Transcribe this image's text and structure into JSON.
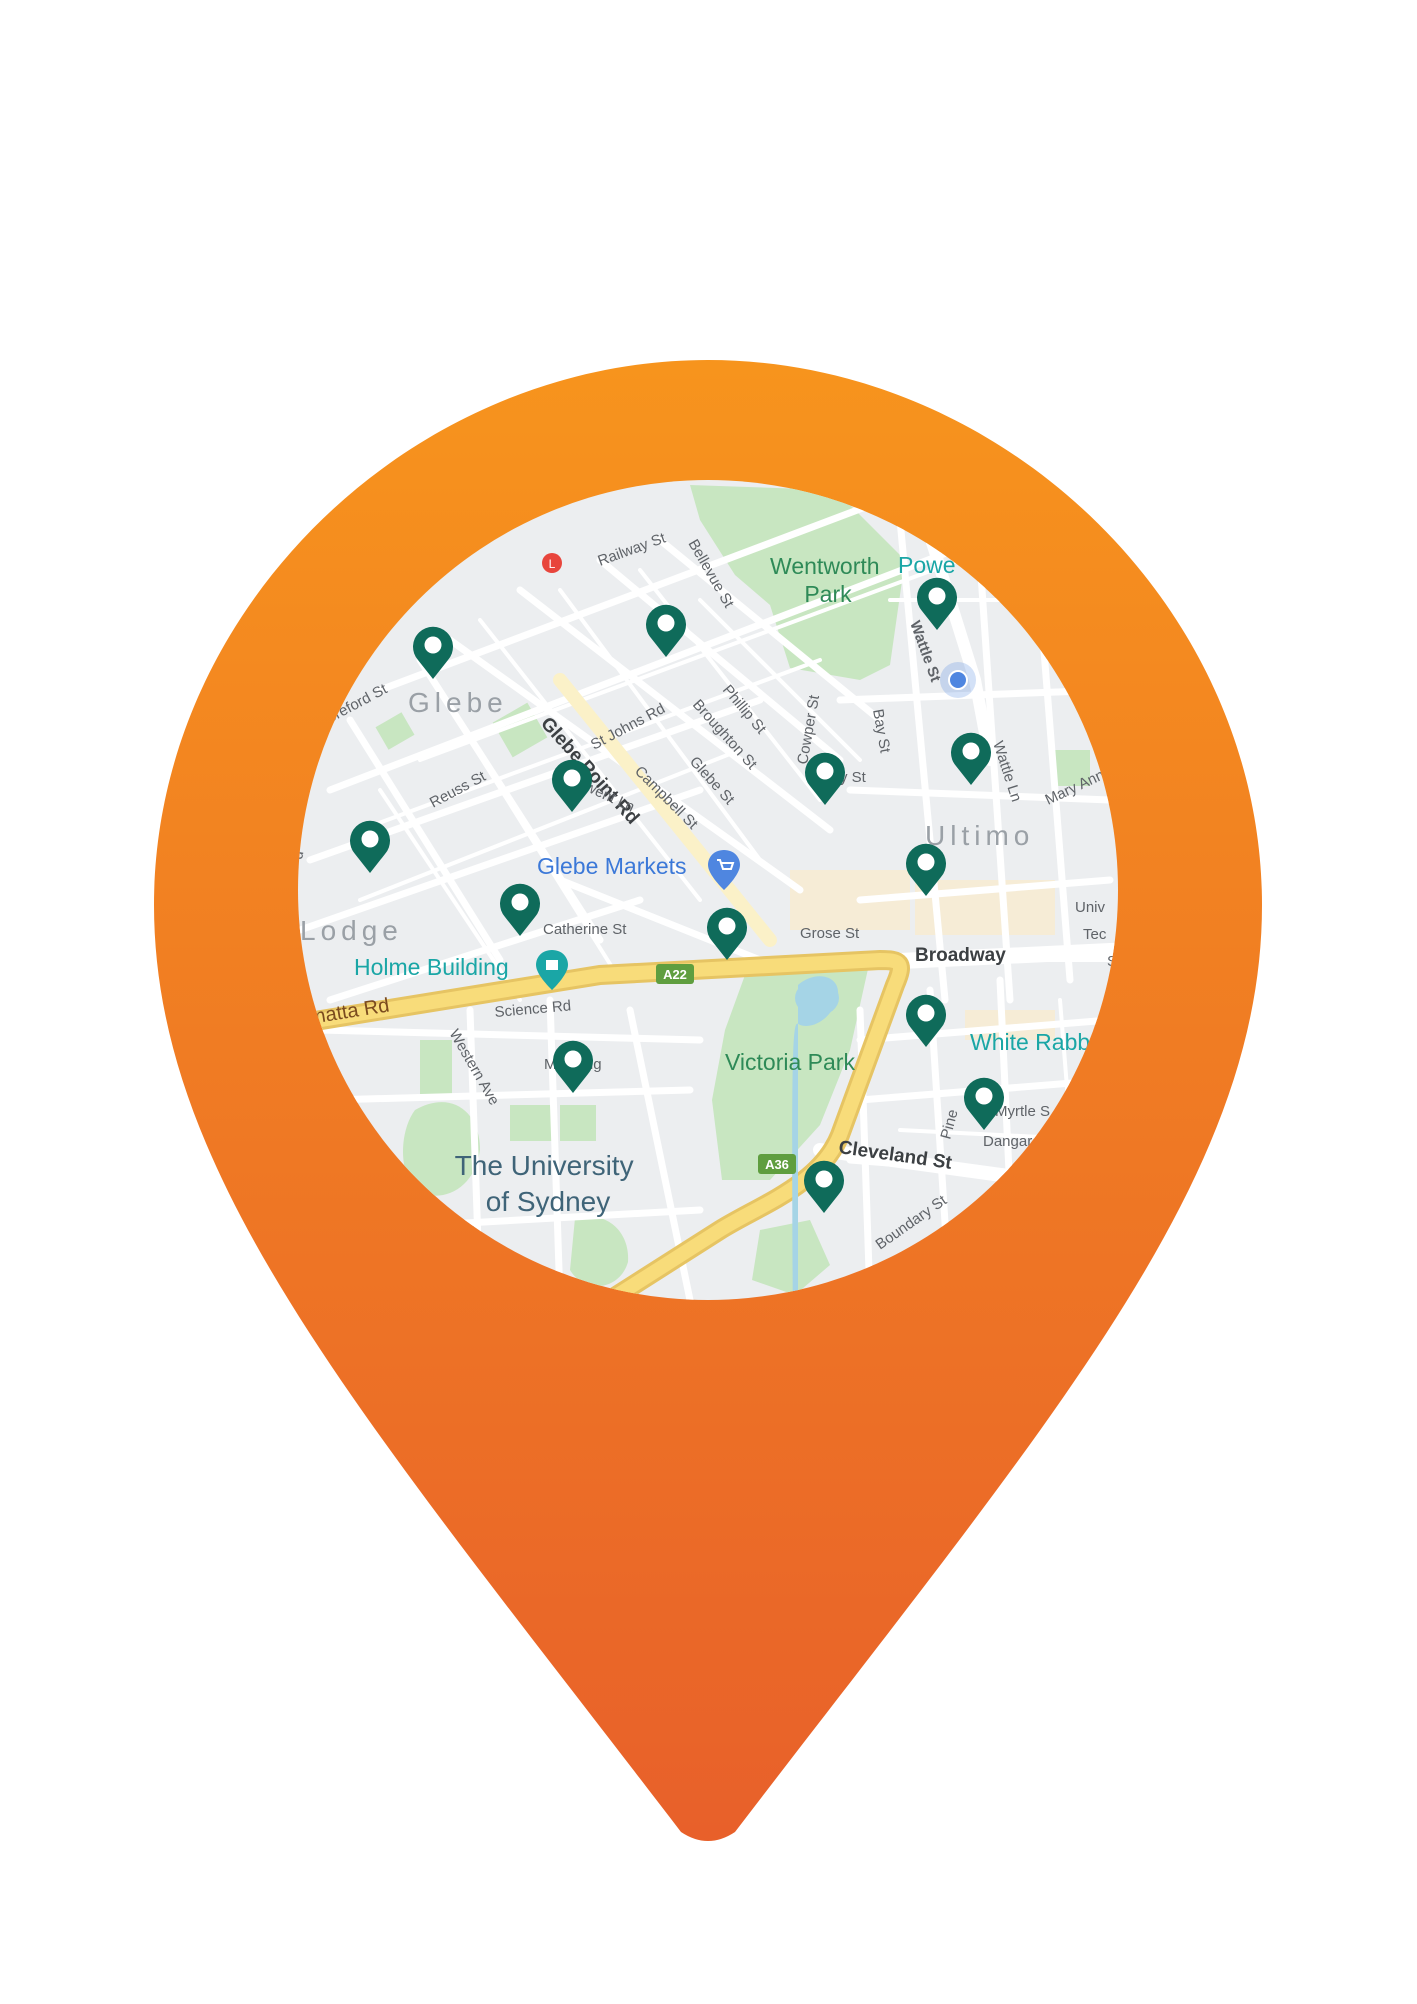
{
  "colors": {
    "pin_top": "#f7941d",
    "pin_bottom": "#e8602a",
    "marker": "#0f6b5a",
    "park": "#c8e6c1",
    "highway": "#f8dc7a",
    "map_bg": "#eceef0"
  },
  "icons": {
    "outer": "location-pin-icon",
    "marker": "map-marker-icon",
    "market": "shopping-cart-icon",
    "landmark": "building-icon",
    "station": "light-rail-icon"
  },
  "map": {
    "district_labels": {
      "glebe": "Glebe",
      "ultimo": "Ultimo",
      "lodge": "Lodge"
    },
    "street_labels": {
      "railway": "Railway St",
      "bellevue": "Bellevue St",
      "st_johns": "St Johns Rd",
      "phillip": "Phillip St",
      "broughton": "Broughton St",
      "cowper": "Cowper St",
      "bay": "Bay St",
      "wattle": "Wattle St",
      "wattle_ln": "Wattle Ln",
      "mary_ann": "Mary Ann",
      "reuss": "Reuss St",
      "hereford": "ereford St",
      "glebe_point": "Glebe Point Rd",
      "went_ln": "went Ln",
      "campbell": "Campbell St",
      "glebe_st": "Glebe St",
      "quarry": "ry St",
      "catherine": "Catherine St",
      "grose": "Grose St",
      "broadway": "Broadway",
      "parramatta": "matta Rd",
      "science": "Science Rd",
      "western": "Western Ave",
      "manning": "Manning",
      "cleveland": "Cleveland St",
      "pine": "Pine",
      "myrtle": "Myrtle S",
      "dangar": "Dangar",
      "boundary": "Boundary St",
      "road_stub": "d"
    },
    "places": {
      "wentworth_line1": "Wentworth",
      "wentworth_line2": "Park",
      "powerhouse": "Powe",
      "glebe_markets": "Glebe Markets",
      "holme_building": "Holme Building",
      "victoria_park": "Victoria Park",
      "white_rabbit": "White Rabb",
      "university_line1": "The University",
      "university_line2": "of Sydney",
      "uts_line1": "Univ",
      "uts_line2": "Tec",
      "uts_line3": "S"
    },
    "road_shields": {
      "a22": "A22",
      "a36": "A36"
    }
  }
}
